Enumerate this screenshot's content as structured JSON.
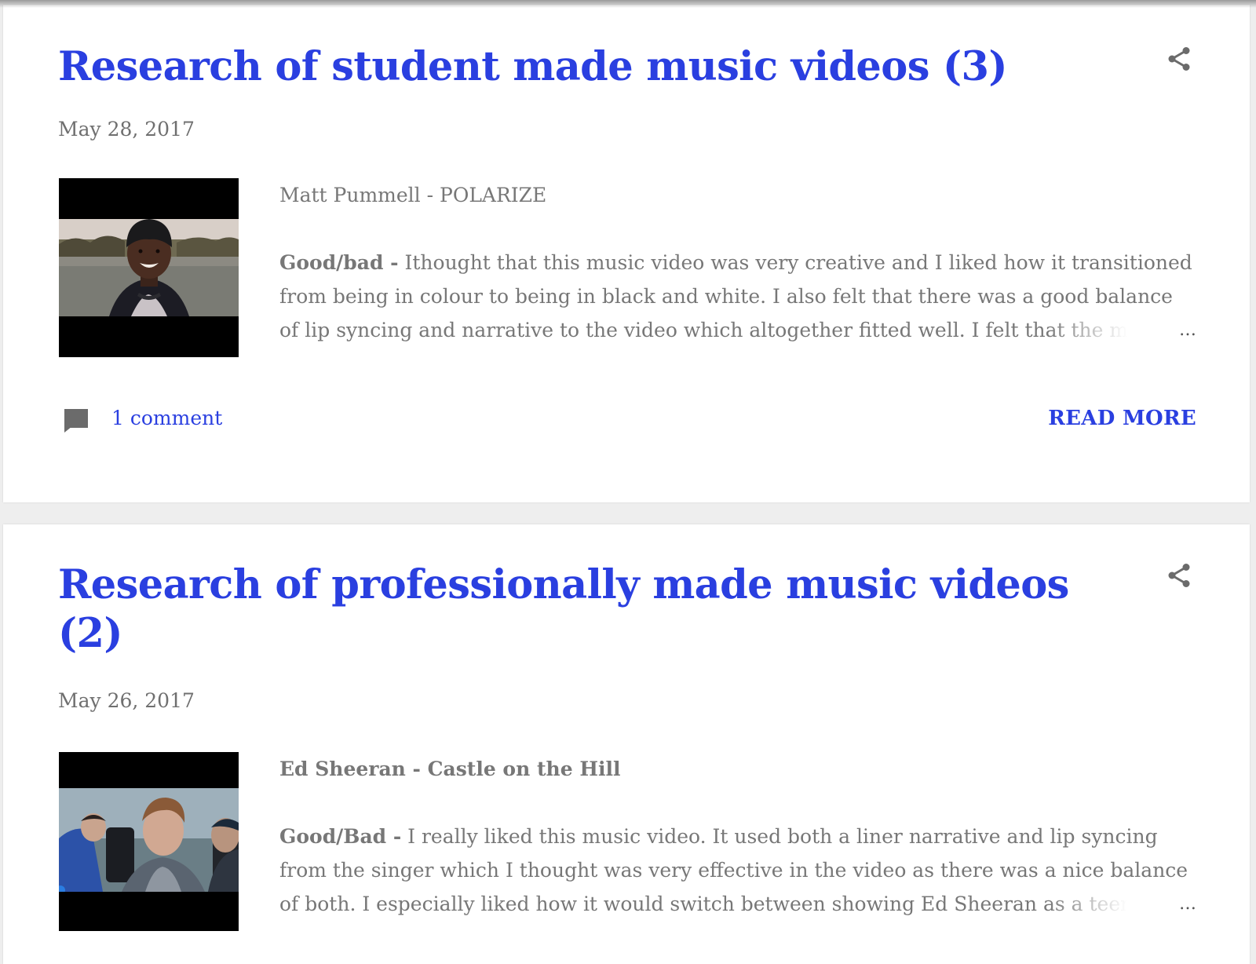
{
  "posts": [
    {
      "title": "Research of student made music videos (3)",
      "date": "May 28, 2017",
      "subtitle": "Matt Pummell - POLARIZE",
      "body_label": "Good/bad -",
      "body_text": " Ithought that this music video was very creative and I liked how it transitioned from being in colour to being in black and white. I also felt that there was a good balance of lip syncing and narrative to the video which altogether fitted well. I felt that the many different editing techniques used made the video interesting.",
      "ellipsis": "…",
      "comments": "1 comment",
      "read_more": "READ MORE",
      "icons": {
        "share": "share-icon",
        "comment": "comment-icon"
      }
    },
    {
      "title": "Research of professionally made music videos (2)",
      "date": "May 26, 2017",
      "subtitle": "Ed Sheeran - Castle on the Hill",
      "body_label": "Good/Bad -",
      "body_text": " I really liked this music video. It used both a liner narrative and lip syncing from the singer which I thought was very effective in the video as there was a nice balance of both. I especially liked how it would switch between showing Ed Sheeran as a teenager who was growing up in the town.",
      "ellipsis": "…",
      "icons": {
        "share": "share-icon"
      }
    }
  ],
  "colors": {
    "link": "#2a3fe0",
    "text": "#777777",
    "background": "#eeeeee",
    "card": "#ffffff"
  }
}
